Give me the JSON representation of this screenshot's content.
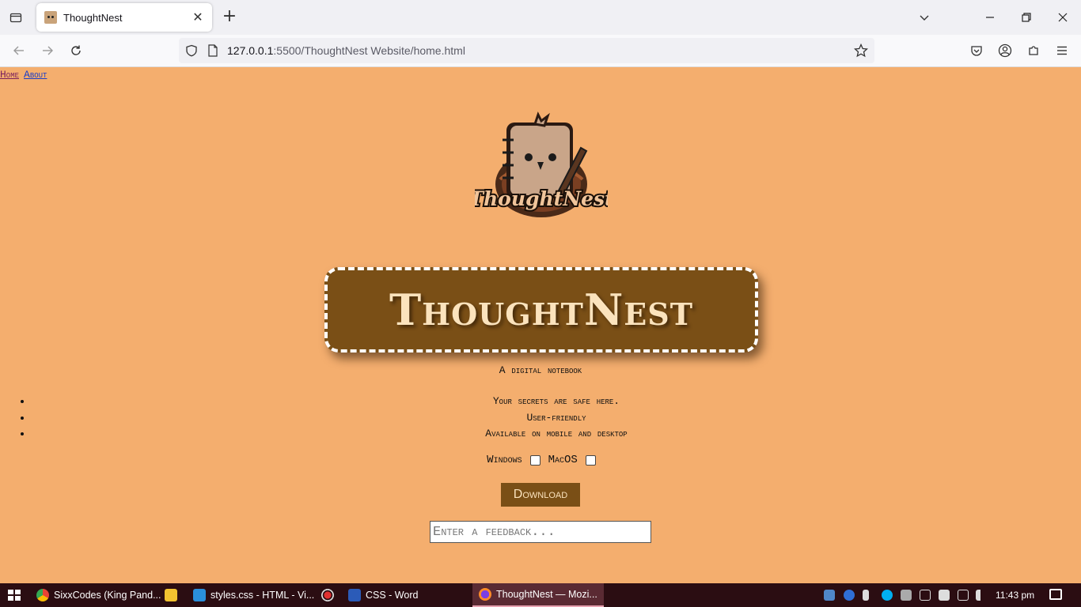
{
  "browser": {
    "tab_title": "ThoughtNest",
    "url_host": "127.0.0.1",
    "url_path": ":5500/ThoughtNest Website/home.html",
    "new_tab_label": "+",
    "close_tab_label": "✕"
  },
  "page": {
    "nav": {
      "home": "Home",
      "about": "About"
    },
    "logo_text": "ThoughtNest",
    "banner_title": "ThoughtNest",
    "subtitle": "A digital notebook",
    "features": [
      "Your secrets are safe here.",
      "User-friendly",
      "Available on mobile and desktop"
    ],
    "os_options": {
      "windows": "Windows",
      "macos": "MacOS"
    },
    "download_label": "Download",
    "feedback_placeholder": "Enter a feedback...",
    "colors": {
      "background": "#f4ae6e",
      "banner": "#7a4f16",
      "banner_text": "#fbe3bd"
    }
  },
  "taskbar": {
    "items": [
      {
        "label": "SixxCodes (King Pand...",
        "icon": "chrome-icon"
      },
      {
        "label": "",
        "icon": "file-explorer-icon"
      },
      {
        "label": "styles.css - HTML - Vi...",
        "icon": "vscode-icon"
      },
      {
        "label": "",
        "icon": "record-icon"
      },
      {
        "label": "CSS - Word",
        "icon": "word-icon"
      },
      {
        "label": "ThoughtNest — Mozi...",
        "icon": "firefox-icon"
      }
    ],
    "time": "11:43 pm"
  }
}
